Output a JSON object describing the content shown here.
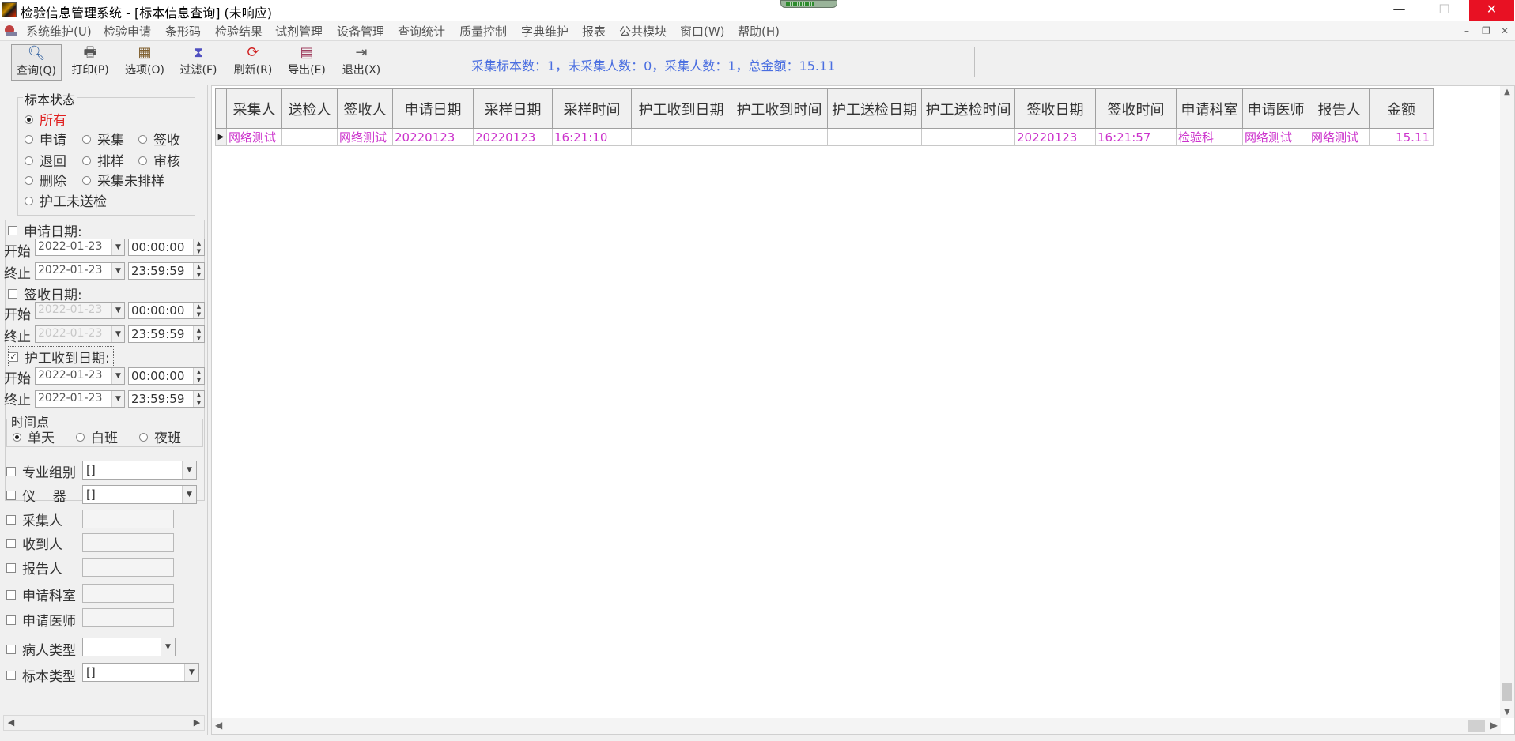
{
  "window": {
    "title": "检验信息管理系统 - [标本信息查询] (未响应)",
    "min_glyph": "—",
    "max_glyph": "☐",
    "close_glyph": "✕"
  },
  "menu": {
    "items": [
      "系统维护(U)",
      "检验申请",
      "条形码",
      "检验结果",
      "试剂管理",
      "设备管理",
      "查询统计",
      "质量控制",
      "字典维护",
      "报表",
      "公共模块",
      "窗口(W)",
      "帮助(H)"
    ],
    "mdi_min": "–",
    "mdi_restore": "❐",
    "mdi_close": "✕"
  },
  "toolbar": {
    "buttons": [
      {
        "label": "查询(Q)",
        "icon": "search-icon",
        "glyph": "🔍"
      },
      {
        "label": "打印(P)",
        "icon": "printer-icon",
        "glyph": "🖶"
      },
      {
        "label": "选项(O)",
        "icon": "options-icon",
        "glyph": "▦"
      },
      {
        "label": "过滤(F)",
        "icon": "hourglass-filter-icon",
        "glyph": "⧗"
      },
      {
        "label": "刷新(R)",
        "icon": "refresh-icon",
        "glyph": "⟳"
      },
      {
        "label": "导出(E)",
        "icon": "book-export-icon",
        "glyph": "📘"
      },
      {
        "label": "退出(X)",
        "icon": "exit-door-icon",
        "glyph": "🚪"
      }
    ],
    "summary": "采集标本数：1，未采集人数：0，采集人数：1，总金额：15.11"
  },
  "left": {
    "status_group": {
      "title": "标本状态",
      "options": [
        "所有",
        "申请",
        "采集",
        "签收",
        "退回",
        "排样",
        "审核",
        "删除",
        "采集未排样",
        "护工未送检"
      ],
      "selected": "所有"
    },
    "apply_date": {
      "label": "申请日期:",
      "checked": false,
      "start_label": "开始",
      "end_label": "终止",
      "start_date": "2022-01-23",
      "start_time": "00:00:00",
      "end_date": "2022-01-23",
      "end_time": "23:59:59"
    },
    "sign_date": {
      "label": "签收日期:",
      "checked": false,
      "start_label": "开始",
      "end_label": "终止",
      "start_date": "2022-01-23",
      "start_time": "00:00:00",
      "end_date": "2022-01-23",
      "end_time": "23:59:59"
    },
    "nurse_date": {
      "label": "护工收到日期:",
      "checked": true,
      "start_label": "开始",
      "end_label": "终止",
      "start_date": "2022-01-23",
      "start_time": "00:00:00",
      "end_date": "2022-01-23",
      "end_time": "23:59:59"
    },
    "timepoint": {
      "title": "时间点",
      "options": [
        "单天",
        "白班",
        "夜班"
      ],
      "selected": "单天"
    },
    "filters": [
      {
        "label": "专业组别",
        "type": "combo",
        "value": "[]"
      },
      {
        "label": "仪    器",
        "type": "combo",
        "value": "[]"
      },
      {
        "label": "采集人",
        "type": "text",
        "value": ""
      },
      {
        "label": "收到人",
        "type": "text",
        "value": ""
      },
      {
        "label": "报告人",
        "type": "text",
        "value": ""
      },
      {
        "label": "申请科室",
        "type": "text",
        "value": ""
      },
      {
        "label": "申请医师",
        "type": "text",
        "value": ""
      },
      {
        "label": "病人类型",
        "type": "combo",
        "value": ""
      },
      {
        "label": "标本类型",
        "type": "combo",
        "value": "[]"
      }
    ]
  },
  "grid": {
    "columns": [
      "采集人",
      "送检人",
      "签收人",
      "申请日期",
      "采样日期",
      "采样时间",
      "护工收到日期",
      "护工收到时间",
      "护工送检日期",
      "护工送检时间",
      "签收日期",
      "签收时间",
      "申请科室",
      "申请医师",
      "报告人",
      "金额"
    ],
    "rows": [
      [
        "网络测试",
        "",
        "网络测试",
        "20220123",
        "20220123",
        "16:21:10",
        "",
        "",
        "",
        "",
        "20220123",
        "16:21:57",
        "检验科",
        "网络测试",
        "网络测试",
        "15.11"
      ]
    ]
  }
}
